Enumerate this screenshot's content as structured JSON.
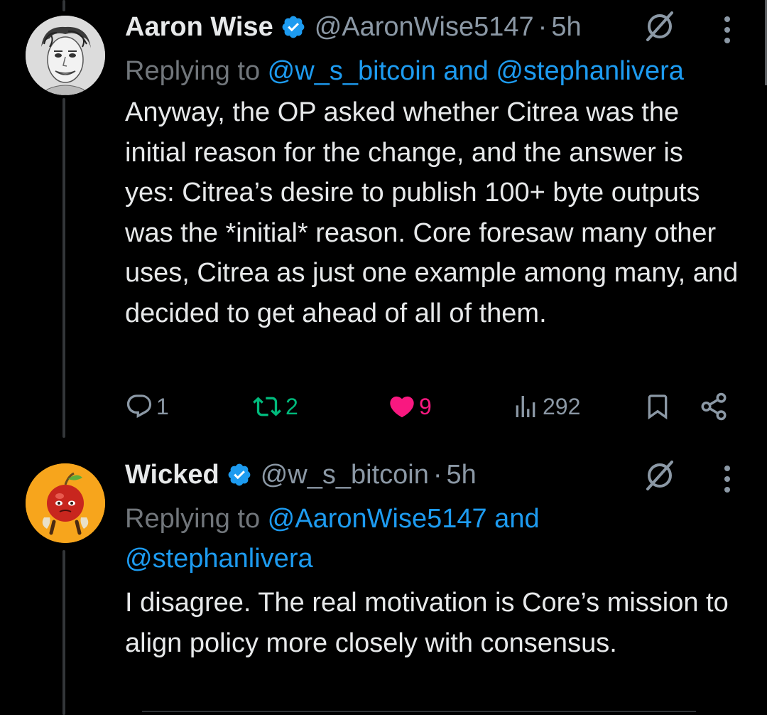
{
  "tweets": [
    {
      "name": "Aaron Wise",
      "handle": "@AaronWise5147",
      "dot": "·",
      "time": "5h",
      "replying_prefix": "Replying to ",
      "replying_to": "@w_s_bitcoin and @stephanlivera",
      "text": "Anyway, the OP asked whether Citrea was the initial reason for the change, and the answer is yes: Citrea’s desire to publish 100+ byte outputs was the *initial* reason. Core foresaw many other uses, Citrea as just one example among many, and decided to get ahead of all of them.",
      "stats": {
        "replies": "1",
        "reposts": "2",
        "likes": "9",
        "views": "292"
      }
    },
    {
      "name": "Wicked",
      "handle": "@w_s_bitcoin",
      "dot": "·",
      "time": "5h",
      "replying_prefix": "Replying to ",
      "replying_to_line1": "@AaronWise5147 and",
      "replying_to_line2": "@stephanlivera",
      "text": "I disagree. The real motivation is Core’s mission to align policy more closely with consensus."
    }
  ],
  "colors": {
    "background": "#000000",
    "text": "#e7e9ea",
    "muted": "#71767b",
    "link": "#1d9bf0",
    "verified": "#1d9bf0",
    "repost": "#00ba7c",
    "like": "#f91880",
    "avatar2_bg": "#f7a51c"
  },
  "icons": [
    "verified-badge-icon",
    "grok-icon",
    "more-icon",
    "reply-icon",
    "repost-icon",
    "like-icon",
    "views-icon",
    "bookmark-icon",
    "share-icon"
  ]
}
